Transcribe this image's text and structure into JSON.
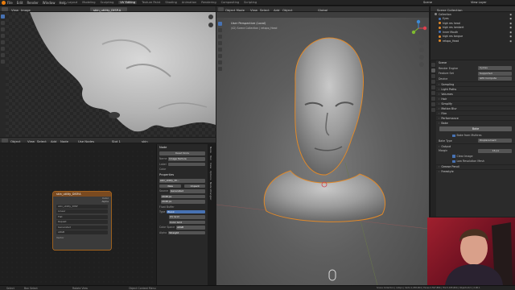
{
  "topbar": {
    "menus": [
      "File",
      "Edit",
      "Render",
      "Window",
      "Help"
    ],
    "workspaces": [
      "Layout",
      "Modeling",
      "Sculpting",
      "UV Editing",
      "Texture Paint",
      "Shading",
      "Animation",
      "Rendering",
      "Compositing",
      "Scripting"
    ],
    "active_workspace": "UV Editing",
    "scene": "Scene",
    "view_layer": "View Layer"
  },
  "image_editor": {
    "view_menu": [
      "View",
      "Image"
    ],
    "image_name": "skin_utility_DISP.A"
  },
  "node_editor": {
    "editor_type": "Object",
    "menus": [
      "View",
      "Select",
      "Add",
      "Node"
    ],
    "use_nodes_label": "Use Nodes",
    "slot": "Slot 1",
    "material": "skin"
  },
  "image_node": {
    "title": "skin_utility_DISP.A",
    "outputs": [
      "Color",
      "Alpha"
    ],
    "image": "skin_utility_DISP",
    "interpolation": "Linear",
    "projection": "Flat",
    "extension": "Repeat",
    "source": "Generated",
    "color_space": "sRGB",
    "vector_label": "Vector"
  },
  "n_panel": {
    "node_section": "Node",
    "reset_node": "Reset Node",
    "name_label": "Name",
    "name_value": "Image Texture",
    "label_label": "Label",
    "color_label": "Color",
    "properties_section": "Properties",
    "image_value": "skin_utility_DI...",
    "new_label": "New",
    "unpack_label": "Unpack",
    "source_label": "Source",
    "source_value": "Generated",
    "width": "2048 px",
    "height": "2048 px",
    "float_buffer": "Float Buffer",
    "type_label": "Type",
    "type_options": [
      "Blank",
      "UV Grid",
      "Color Grid"
    ],
    "color_space_label": "Color Space",
    "color_space_value": "sRGB",
    "alpha_label": "Alpha",
    "alpha_value": "Straight",
    "tabs": [
      "Node",
      "Tool",
      "View",
      "Options",
      "Node Wrangler"
    ]
  },
  "viewport": {
    "mode": "Object Mode",
    "menus": [
      "View",
      "Select",
      "Add",
      "Object"
    ],
    "orientation": "Global",
    "overlay_title": "User Perspective (Local)",
    "overlay_sub": "(42) Scene Collection | retopo_Head"
  },
  "outliner": {
    "title": "Scene Collection",
    "items": [
      "Collection",
      "Eyes",
      "high res head",
      "high res lambert",
      "Inner Mouth",
      "high res tongue",
      "retopo_Head"
    ]
  },
  "properties": {
    "scene": "Scene",
    "render_engine_label": "Render Engine",
    "render_engine": "Cycles",
    "feature_set_label": "Feature Set",
    "feature_set": "Supported",
    "device_label": "Device",
    "device": "GPU Compute",
    "sections": [
      "Sampling",
      "Light Paths",
      "Volumes",
      "Hair",
      "Simplify",
      "Motion Blur",
      "Film",
      "Performance",
      "Bake"
    ],
    "bake_button": "Bake",
    "bake_from_multires": "Bake from Multires",
    "bake_type_label": "Bake Type",
    "bake_type": "Displacement",
    "output_label": "Output",
    "margin_label": "Margin",
    "margin": "16 px",
    "clear_image": "Clear Image",
    "low_res_mesh": "Low Resolution Mesh",
    "bottom_sections": [
      "Grease Pencil",
      "Freestyle"
    ]
  },
  "statusbar": {
    "select": "Select",
    "box_select": "Box Select",
    "rotate_view": "Rotate View",
    "context_menu": "Object Context Menu",
    "stats": "Scene Collection | retopo | Verts:1,258,064 | Faces:2,597,884 | Tris:5,195,804 | Objects:0/1 | 2.90.1"
  },
  "colors": {
    "accent": "#4772b3",
    "selection": "#f08b1d",
    "node_header": "#7a4a20"
  }
}
